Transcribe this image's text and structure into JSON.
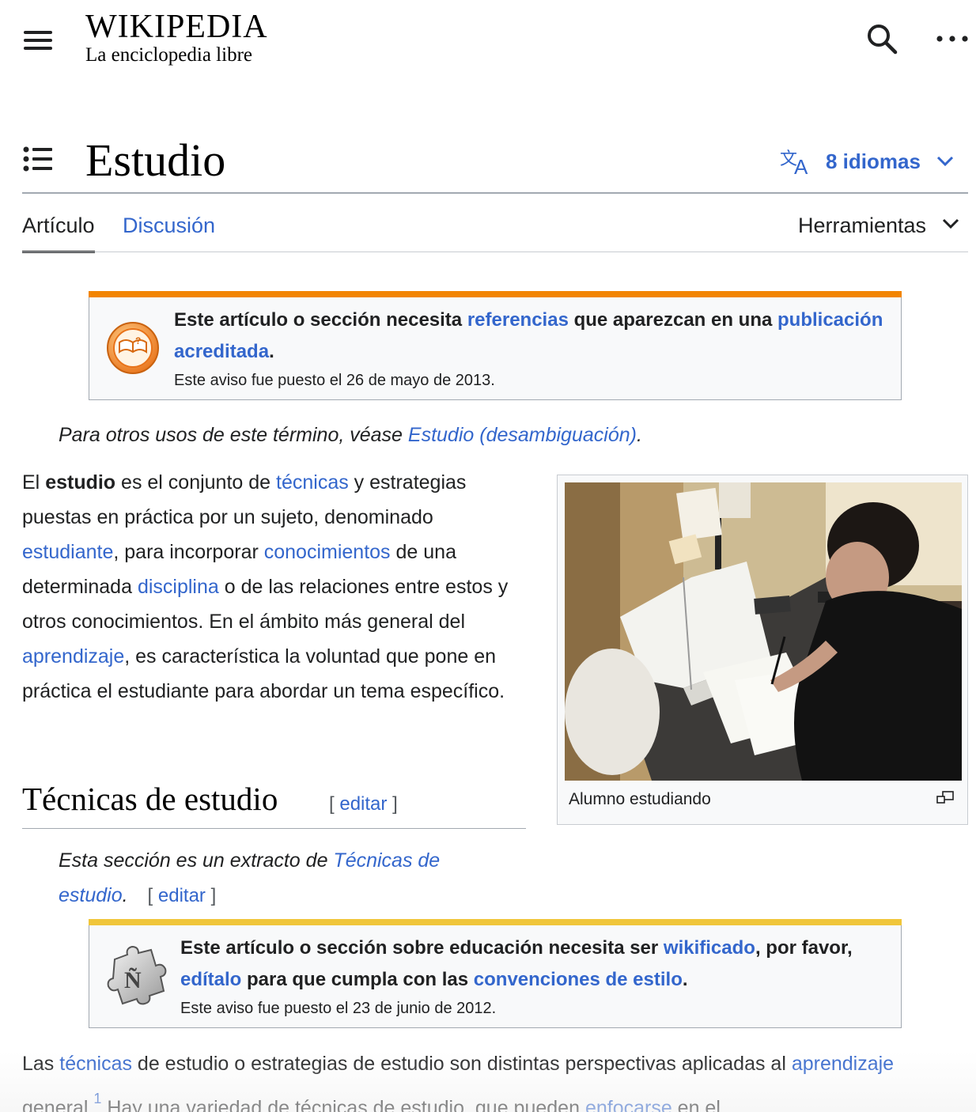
{
  "header": {
    "logo_word": "WIKIPEDIA",
    "logo_tagline": "La enciclopedia libre",
    "menu_icon": "hamburger-icon",
    "search_icon": "search-icon",
    "more_icon": "ellipsis-icon"
  },
  "title": {
    "text": "Estudio",
    "toc_icon": "list-icon",
    "languages_label": "8 idiomas",
    "languages_icon": "translate-icon"
  },
  "tabs": {
    "article": "Artículo",
    "talk": "Discusión",
    "tools": "Herramientas"
  },
  "notice1": {
    "text_pre": "Este artículo o sección necesita ",
    "link1": "referencias",
    "text_mid": " que aparezcan en una ",
    "link2": "publicación acreditada",
    "text_post": ".",
    "date": "Este aviso fue puesto el 26 de mayo de 2013.",
    "icon": "book-question-icon",
    "color": "#f28500"
  },
  "hatnote": {
    "text": "Para otros usos de este término, véase ",
    "link": "Estudio (desambiguación)",
    "end": "."
  },
  "intro": {
    "t1": "El ",
    "b1": "estudio",
    "t2": " es el conjunto de ",
    "l1": "técnicas",
    "t3": " y estrategias puestas en práctica por un sujeto, denominado ",
    "l2": "estudiante",
    "t4": ", para incorporar ",
    "l3": "conocimientos",
    "t5": " de una determinada ",
    "l4": "disciplina",
    "t6": " o de las relaciones entre estos y otros conocimientos. En el ámbito más general del ",
    "l5": "aprendizaje",
    "t7": ", es característica la voluntad que pone en práctica el estudiante para abordar un tema específico."
  },
  "thumbnail": {
    "caption": "Alumno estudiando",
    "enlarge_icon": "magnify-clip-icon"
  },
  "section": {
    "heading": "Técnicas de estudio",
    "edit_open": "[",
    "edit_label": "editar",
    "edit_close": "]"
  },
  "excerpt": {
    "text": "Esta sección es un extracto de ",
    "link": "Técnicas de estudio",
    "end": ".",
    "edit_open": "[",
    "edit_label": "editar",
    "edit_close": "]"
  },
  "notice2": {
    "text_pre": "Este artículo o sección sobre educación necesita ser ",
    "link1": "wikificado",
    "text_mid": ", por favor, ",
    "link2": "edítalo",
    "text_mid2": " para que cumpla con las ",
    "link3": "convenciones de estilo",
    "text_post": ".",
    "date": "Este aviso fue puesto el 23 de junio de 2012.",
    "icon": "puzzle-piece-icon",
    "color": "#f0c63a"
  },
  "body2": {
    "t1": "Las ",
    "l1": "técnicas",
    "t2": " de estudio o estrategias de estudio son distintas perspectivas aplicadas al ",
    "l2": "aprendizaje",
    "t3": " general.",
    "ref": "1",
    "t4": " Hay una variedad de técnicas de estudio, que pueden ",
    "l3": "enfocarse",
    "t5": " en el"
  }
}
